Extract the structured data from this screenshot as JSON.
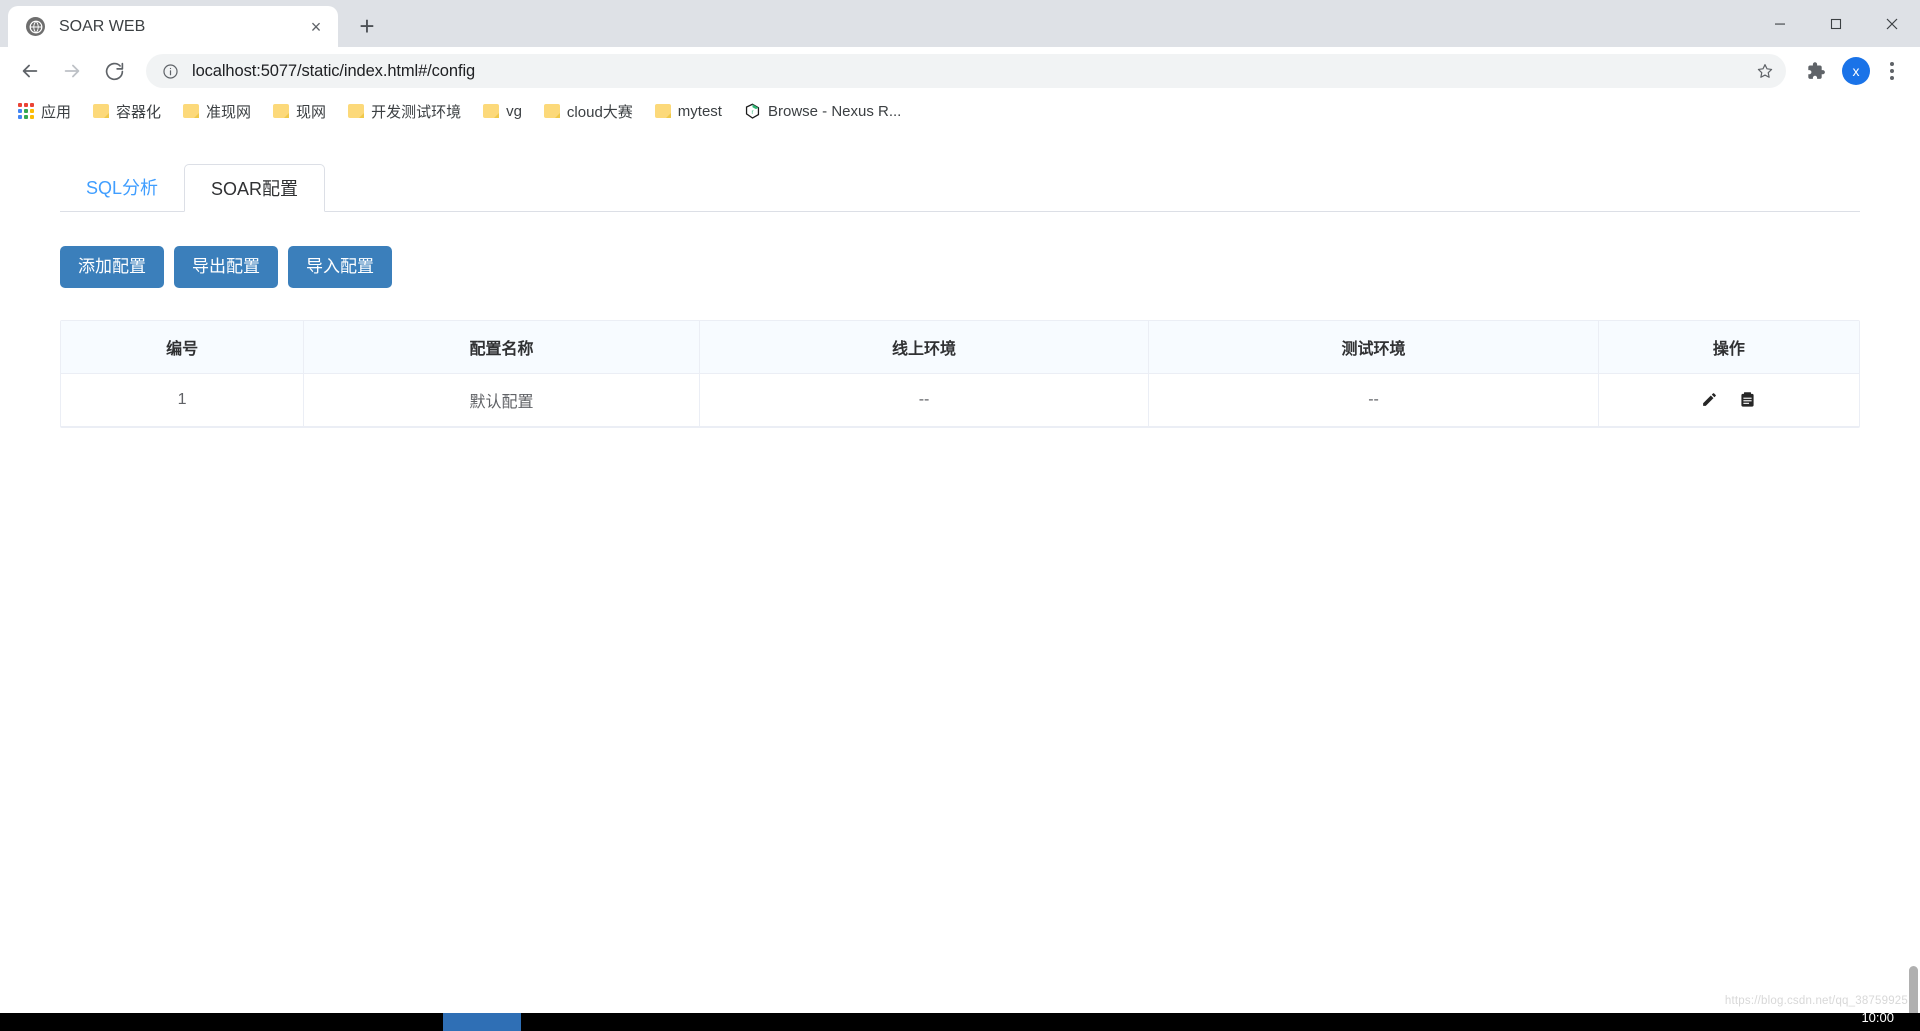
{
  "browser": {
    "tab": {
      "title": "SOAR WEB",
      "favicon": "globe-icon",
      "close": "×"
    },
    "new_tab_label": "+",
    "window_controls": {
      "minimize": "—",
      "maximize": "☐",
      "close": "✕"
    },
    "nav": {
      "back": "←",
      "forward": "→",
      "reload": "↻"
    },
    "omnibox": {
      "url": "localhost:5077/static/index.html#/config",
      "info_icon": "info-circle-icon",
      "star_icon": "star-icon"
    },
    "extensions_icon": "puzzle-icon",
    "profile_initial": "x",
    "menu_icon": "three-dots-icon",
    "bookmarks": [
      {
        "label": "应用",
        "icon": "apps-grid-icon"
      },
      {
        "label": "容器化",
        "icon": "folder-icon"
      },
      {
        "label": "准现网",
        "icon": "folder-icon"
      },
      {
        "label": "现网",
        "icon": "folder-icon"
      },
      {
        "label": "开发测试环境",
        "icon": "folder-icon"
      },
      {
        "label": "vg",
        "icon": "folder-icon"
      },
      {
        "label": "cloud大赛",
        "icon": "folder-icon"
      },
      {
        "label": "mytest",
        "icon": "folder-icon"
      },
      {
        "label": "Browse - Nexus R...",
        "icon": "nexus-icon"
      }
    ]
  },
  "app": {
    "tabs": [
      {
        "label": "SQL分析",
        "active": false
      },
      {
        "label": "SOAR配置",
        "active": true
      }
    ],
    "toolbar_buttons": [
      {
        "label": "添加配置"
      },
      {
        "label": "导出配置"
      },
      {
        "label": "导入配置"
      }
    ],
    "table": {
      "columns": [
        "编号",
        "配置名称",
        "线上环境",
        "测试环境",
        "操作"
      ],
      "rows": [
        {
          "id": "1",
          "name": "默认配置",
          "online_env": "--",
          "test_env": "--",
          "actions": [
            "edit-pencil-icon",
            "copy-clipboard-icon"
          ]
        }
      ]
    },
    "watermark": "https://blog.csdn.net/qq_38759925"
  },
  "taskbar": {
    "clock": "10:00"
  },
  "colors": {
    "accent_button": "#3b7fbb",
    "tab_link": "#409eff",
    "table_header_bg": "#f7fbff",
    "chrome_tabstrip": "#dee1e6",
    "profile_blue": "#1a73e8"
  }
}
